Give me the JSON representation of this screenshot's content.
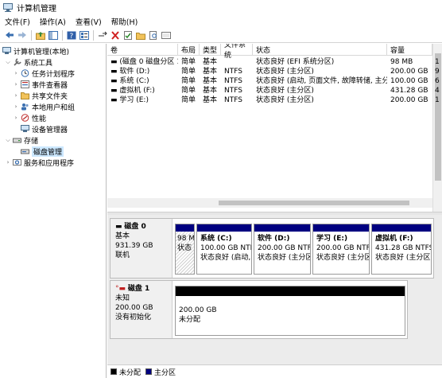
{
  "window": {
    "title": "计算机管理"
  },
  "menu": [
    "文件(F)",
    "操作(A)",
    "查看(V)",
    "帮助(H)"
  ],
  "tree": {
    "root": "计算机管理(本地)",
    "system_tools": "系统工具",
    "task_scheduler": "任务计划程序",
    "event_viewer": "事件查看器",
    "shared_folders": "共享文件夹",
    "local_users": "本地用户和组",
    "performance": "性能",
    "device_manager": "设备管理器",
    "storage": "存储",
    "disk_management": "磁盘管理",
    "services": "服务和应用程序"
  },
  "table": {
    "headers": [
      "卷",
      "布局",
      "类型",
      "文件系统",
      "状态",
      "容量"
    ],
    "rows": [
      [
        "(磁盘 0 磁盘分区 1)",
        "简单",
        "基本",
        "",
        "状态良好 (EFI 系统分区)",
        "98 MB"
      ],
      [
        "软件 (D:)",
        "简单",
        "基本",
        "NTFS",
        "状态良好 (主分区)",
        "200.00 GB"
      ],
      [
        "系统 (C:)",
        "简单",
        "基本",
        "NTFS",
        "状态良好 (启动, 页面文件, 故障转储, 主分区)",
        "100.00 GB"
      ],
      [
        "虚拟机 (F:)",
        "简单",
        "基本",
        "NTFS",
        "状态良好 (主分区)",
        "431.28 GB"
      ],
      [
        "学习 (E:)",
        "简单",
        "基本",
        "NTFS",
        "状态良好 (主分区)",
        "200.00 GB"
      ]
    ],
    "extra_col": [
      "1",
      "9",
      "6",
      "4",
      "1"
    ]
  },
  "disk0": {
    "name": "磁盘 0",
    "type": "基本",
    "size": "931.39 GB",
    "status": "联机",
    "partitions": [
      {
        "name": "",
        "size": "98 M",
        "status": "状态"
      },
      {
        "name": "系统  (C:)",
        "size": "100.00 GB NTF",
        "status": "状态良好 (启动,"
      },
      {
        "name": "软件  (D:)",
        "size": "200.00 GB NTFS",
        "status": "状态良好 (主分区)"
      },
      {
        "name": "学习  (E:)",
        "size": "200.00 GB NTFS",
        "status": "状态良好 (主分区"
      },
      {
        "name": "虚拟机  (F:)",
        "size": "431.28 GB NTFS",
        "status": "状态良好 (主分区)"
      }
    ]
  },
  "disk1": {
    "name": "磁盘 1",
    "type": "未知",
    "size": "200.00 GB",
    "status": "没有初始化",
    "partition": {
      "size": "200.00 GB",
      "status": "未分配"
    }
  },
  "legend": {
    "unallocated": "未分配",
    "primary": "主分区"
  },
  "colors": {
    "primary": "#000080",
    "unallocated": "#000000",
    "selection": "#cce8ff"
  }
}
